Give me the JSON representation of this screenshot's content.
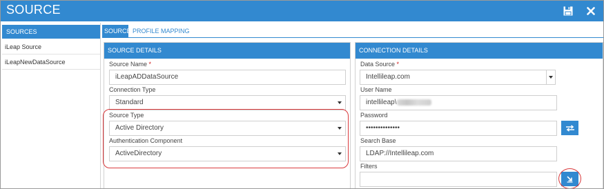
{
  "window": {
    "title": "SOURCE",
    "save_icon": "floppy-disk-icon",
    "close_icon": "close-icon"
  },
  "sidebar": {
    "header": "SOURCES",
    "items": [
      {
        "label": "iLeap Source"
      },
      {
        "label": "iLeapNewDataSource"
      }
    ]
  },
  "tabs": [
    {
      "label": "SOURCE",
      "active": true
    },
    {
      "label": "PROFILE MAPPING",
      "active": false
    }
  ],
  "source_details": {
    "header": "SOURCE DETAILS",
    "source_name": {
      "label": "Source Name",
      "required_mark": "*",
      "value": "iLeapADDataSource"
    },
    "connection_type": {
      "label": "Connection Type",
      "value": "Standard"
    },
    "source_type": {
      "label": "Source Type",
      "value": "Active Directory"
    },
    "authentication_component": {
      "label": "Authentication Component",
      "value": "ActiveDirectory"
    }
  },
  "connection_details": {
    "header": "CONNECTION DETAILS",
    "data_source": {
      "label": "Data Source",
      "required_mark": "*",
      "value": "Intellileap.com"
    },
    "user_name": {
      "label": "User Name",
      "value": "intellileap\\"
    },
    "password": {
      "label": "Password",
      "value": "••••••••••••••"
    },
    "search_base": {
      "label": "Search Base",
      "value": "LDAP://Intellileap.com"
    },
    "filters": {
      "label": "Filters",
      "value": ""
    }
  },
  "colors": {
    "accent": "#3289d0",
    "highlight": "#d9393c"
  }
}
